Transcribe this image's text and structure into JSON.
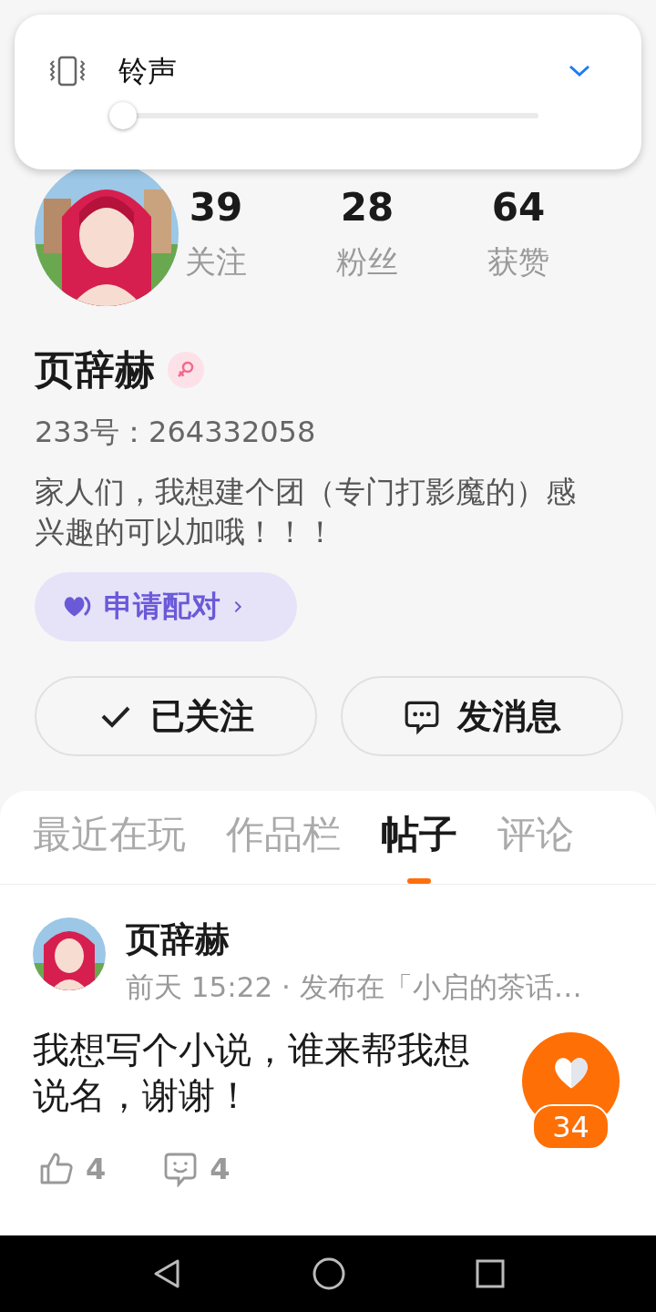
{
  "volume_panel": {
    "label": "铃声",
    "slider": {
      "level": 0
    }
  },
  "profile": {
    "stats": [
      {
        "value": "39",
        "label": "关注"
      },
      {
        "value": "28",
        "label": "粉丝"
      },
      {
        "value": "64",
        "label": "获赞"
      }
    ],
    "name": "页辞赫",
    "id_line": "233号：264332058",
    "bio": "家人们，我想建个团（专门打影魔的）感兴趣的可以加哦！！！",
    "match_button": "申请配对",
    "actions": [
      {
        "kind": "follow",
        "label": "已关注"
      },
      {
        "kind": "message",
        "label": "发消息"
      }
    ]
  },
  "tabs": [
    {
      "label": "最近在玩",
      "selected": false
    },
    {
      "label": "作品栏",
      "selected": false
    },
    {
      "label": "帖子",
      "selected": true
    },
    {
      "label": "评论",
      "selected": false
    }
  ],
  "post": {
    "author": "页辞赫",
    "meta": "前天 15:22 · 发布在「小启的茶话…",
    "body_lines": [
      "我想写个小说，谁来帮我想",
      "说名，谢谢！"
    ],
    "likes": "4",
    "comments": "4"
  },
  "float_like": {
    "count": "34"
  }
}
